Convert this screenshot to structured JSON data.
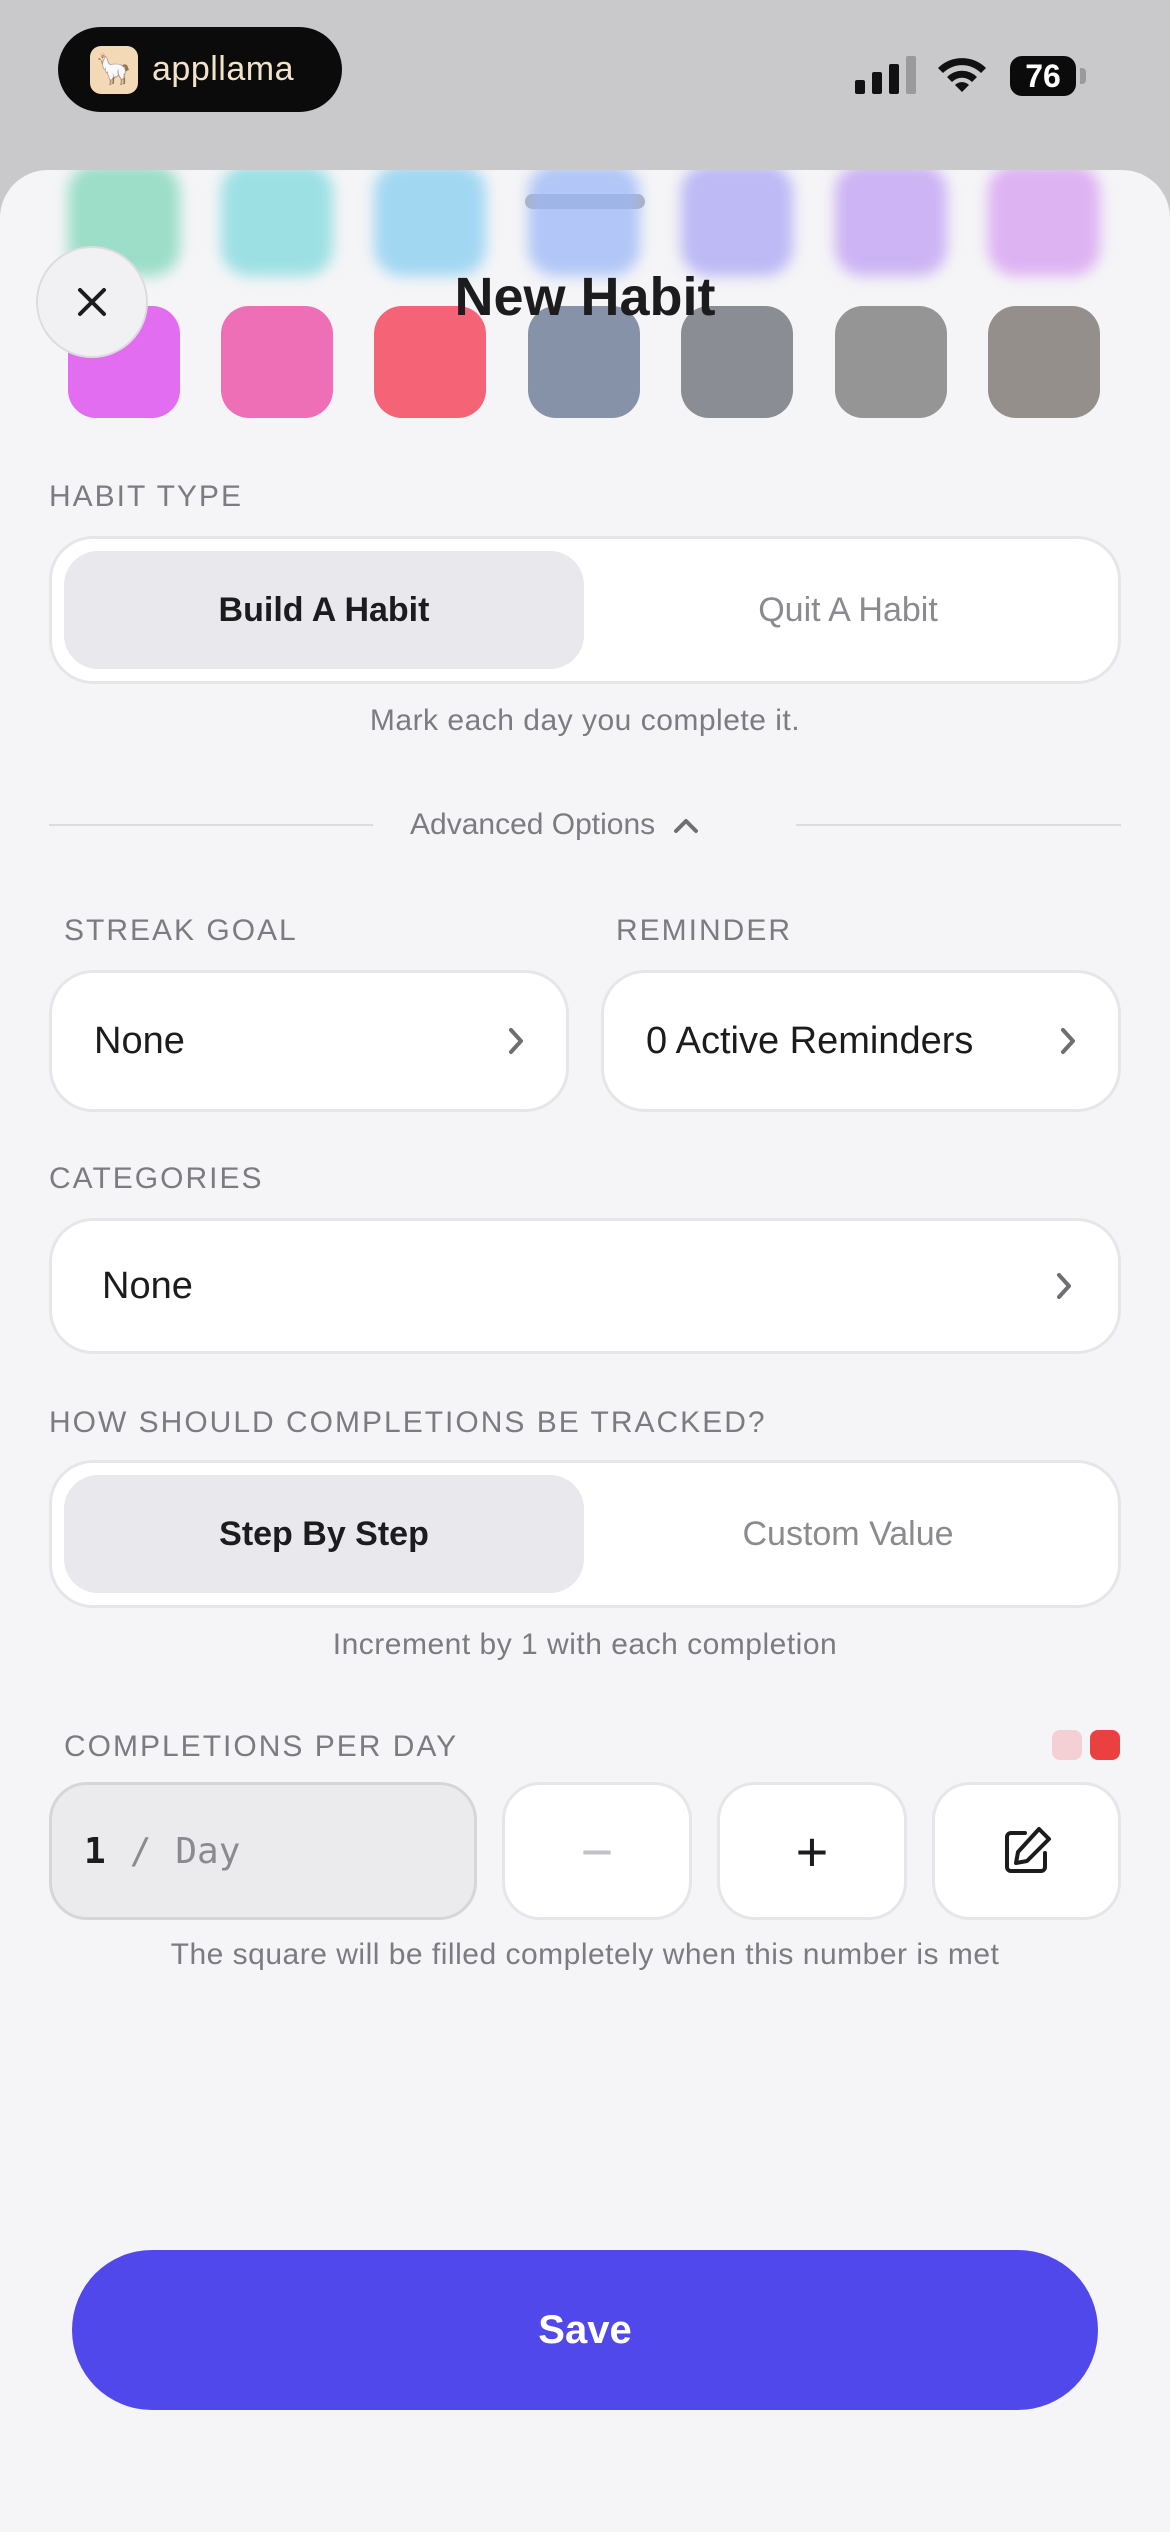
{
  "status_bar": {
    "app_name": "appllama",
    "battery": "76",
    "icons": [
      "signal-icon",
      "wifi-icon",
      "battery-icon"
    ]
  },
  "sheet": {
    "title": "New Habit",
    "close_icon": "close-icon"
  },
  "colors": {
    "row_top": [
      "#7ed6b8",
      "#7fd9de",
      "#86cdf1",
      "#9bb7f7",
      "#aaa6f4",
      "#bf9ef3",
      "#d69cf1"
    ],
    "row_bottom": [
      "#e26df0",
      "#ee6fb6",
      "#f56377",
      "#8692a7",
      "#8a8d93",
      "#959595",
      "#958f8b"
    ],
    "accent": "#5148ec",
    "completion_light": "#f4cfd3",
    "completion_dark": "#ea4040"
  },
  "habit_type": {
    "label": "HABIT TYPE",
    "options": [
      "Build A Habit",
      "Quit A Habit"
    ],
    "selected": "Build A Habit",
    "hint": "Mark each day you complete it."
  },
  "advanced": {
    "label": "Advanced Options",
    "expanded": true
  },
  "streak_goal": {
    "label": "STREAK GOAL",
    "value": "None"
  },
  "reminder": {
    "label": "REMINDER",
    "value": "0 Active Reminders"
  },
  "categories": {
    "label": "CATEGORIES",
    "value": "None"
  },
  "tracking": {
    "label": "HOW SHOULD COMPLETIONS BE TRACKED?",
    "options": [
      "Step By Step",
      "Custom Value"
    ],
    "selected": "Step By Step",
    "hint": "Increment by 1 with each completion"
  },
  "completions": {
    "label": "COMPLETIONS PER DAY",
    "value": "1",
    "separator": "/",
    "unit": "Day",
    "minus": "−",
    "plus": "+",
    "hint": "The square will be filled completely when this number is met"
  },
  "save_label": "Save"
}
